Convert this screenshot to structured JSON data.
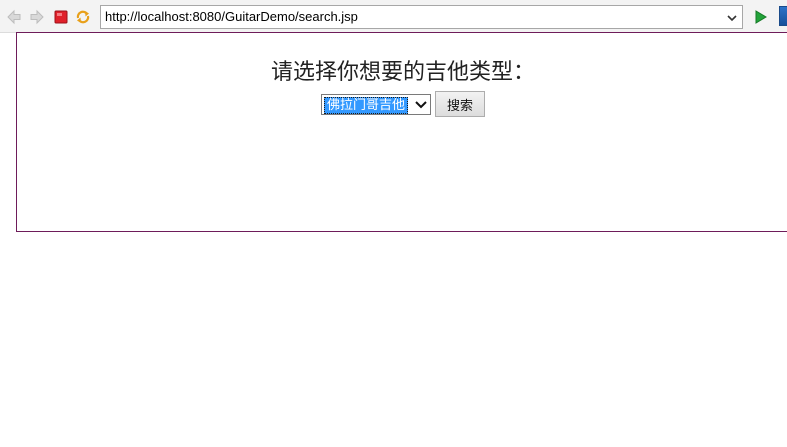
{
  "browser": {
    "url": "http://localhost:8080/GuitarDemo/search.jsp",
    "icons": {
      "back": "back-arrow-icon",
      "forward": "forward-arrow-icon",
      "stop": "stop-icon",
      "refresh": "refresh-icon",
      "url_dropdown": "chevron-down-icon",
      "go": "go-play-icon"
    }
  },
  "page": {
    "heading": "请选择你想要的吉他类型：",
    "guitar_type_select": {
      "selected": "佛拉门哥吉他"
    },
    "search_button_label": "搜索"
  },
  "colors": {
    "selection_highlight": "#3399ff",
    "frame_border": "#6e1c5a",
    "go_button": "#22a33a",
    "stop_button": "#e0202a"
  }
}
